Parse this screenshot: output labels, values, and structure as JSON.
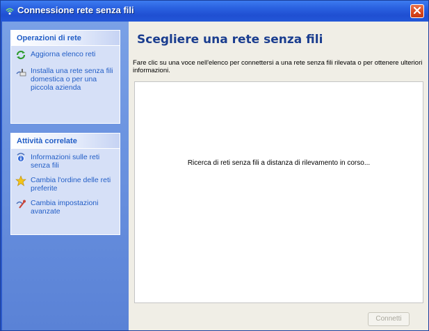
{
  "window": {
    "title": "Connessione rete senza fili"
  },
  "sidebar": {
    "sections": [
      {
        "title": "Operazioni di rete",
        "items": [
          {
            "label": "Aggiorna elenco reti",
            "icon": "refresh-icon"
          },
          {
            "label": "Installa una rete senza fili domestica o per una piccola azienda",
            "icon": "setup-network-icon"
          }
        ]
      },
      {
        "title": "Attività correlate",
        "items": [
          {
            "label": "Informazioni sulle reti senza fili",
            "icon": "info-icon"
          },
          {
            "label": "Cambia l'ordine delle reti preferite",
            "icon": "star-icon"
          },
          {
            "label": "Cambia impostazioni avanzate",
            "icon": "settings-icon"
          }
        ]
      }
    ]
  },
  "main": {
    "heading": "Scegliere una rete senza fili",
    "description": "Fare clic su una voce nell'elenco per connettersi a una rete senza fili rilevata o per ottenere ulteriori informazioni.",
    "status": "Ricerca di reti senza fili a distanza di rilevamento in corso...",
    "connect_label": "Connetti"
  },
  "colors": {
    "titlebar": "#2a61e0",
    "sidebar": "#6b93e0",
    "panel": "#d6e0f7",
    "link": "#215dc6",
    "heading": "#1a3d8f",
    "close": "#d9461c"
  }
}
